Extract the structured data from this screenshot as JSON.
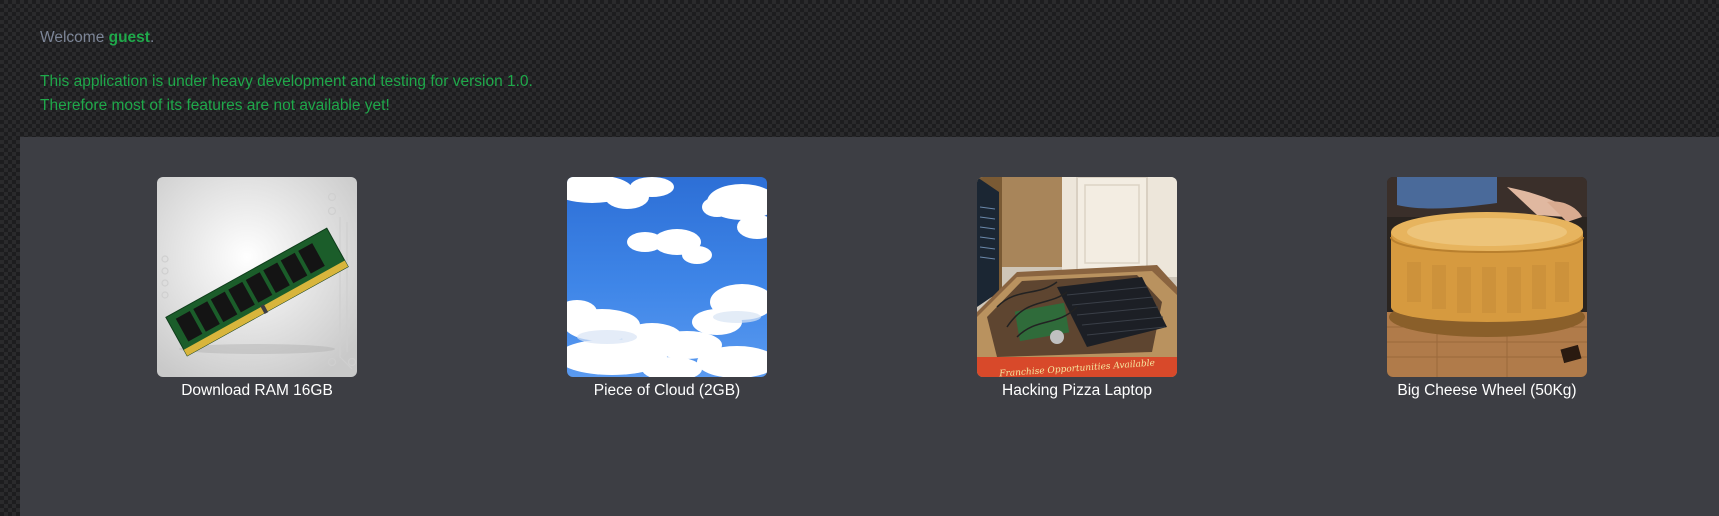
{
  "header": {
    "welcome_prefix": "Welcome ",
    "username": "guest",
    "welcome_suffix": ".",
    "notice_line1": "This application is under heavy development and testing for version 1.0.",
    "notice_line2": "Therefore most of its features are not available yet!"
  },
  "products": [
    {
      "name": "Download RAM 16GB",
      "icon": "ram-module-image"
    },
    {
      "name": "Piece of Cloud (2GB)",
      "icon": "cloud-sky-image"
    },
    {
      "name": "Hacking Pizza Laptop",
      "icon": "pizza-box-laptop-image"
    },
    {
      "name": "Big Cheese Wheel (50Kg)",
      "icon": "cheese-wheel-image"
    }
  ],
  "pizza_box_text": "Franchise Opportunities Available",
  "colors": {
    "accent_green": "#1fa84a",
    "muted_text": "#7c8597",
    "panel_bg": "#3d3e44"
  }
}
